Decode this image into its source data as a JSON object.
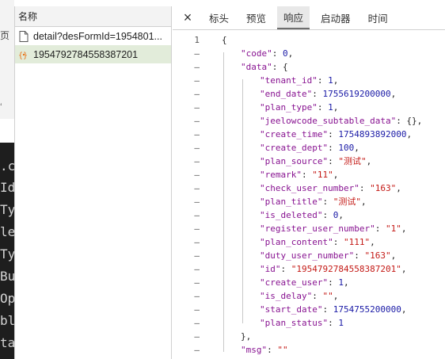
{
  "background": {
    "partial_chars": [
      "页",
      "ʻ",
      ".c",
      "Id",
      "Ty",
      "le",
      "Ty",
      "Bu",
      "Op",
      "bl",
      "ta"
    ]
  },
  "request_list": {
    "header": "名称",
    "items": [
      {
        "name": "detail?desFormId=1954801...",
        "icon": "document-icon",
        "selected": false
      },
      {
        "name": "1954792784558387201",
        "icon": "json-icon",
        "selected": true
      }
    ]
  },
  "tabs": {
    "close": "×",
    "items": [
      "标头",
      "预览",
      "响应",
      "启动器",
      "时间"
    ],
    "active": "响应"
  },
  "response": {
    "gutter_first": "1",
    "gutter_other": "–",
    "lines": [
      {
        "indent": 0,
        "parts": [
          {
            "t": "{",
            "c": "punc"
          }
        ]
      },
      {
        "indent": 1,
        "parts": [
          {
            "t": "\"code\"",
            "c": "key"
          },
          {
            "t": ": ",
            "c": "punc"
          },
          {
            "t": "0",
            "c": "num"
          },
          {
            "t": ",",
            "c": "punc"
          }
        ]
      },
      {
        "indent": 1,
        "parts": [
          {
            "t": "\"data\"",
            "c": "key"
          },
          {
            "t": ": {",
            "c": "punc"
          }
        ]
      },
      {
        "indent": 2,
        "parts": [
          {
            "t": "\"tenant_id\"",
            "c": "key"
          },
          {
            "t": ": ",
            "c": "punc"
          },
          {
            "t": "1",
            "c": "num"
          },
          {
            "t": ",",
            "c": "punc"
          }
        ]
      },
      {
        "indent": 2,
        "parts": [
          {
            "t": "\"end_date\"",
            "c": "key"
          },
          {
            "t": ": ",
            "c": "punc"
          },
          {
            "t": "1755619200000",
            "c": "num"
          },
          {
            "t": ",",
            "c": "punc"
          }
        ]
      },
      {
        "indent": 2,
        "parts": [
          {
            "t": "\"plan_type\"",
            "c": "key"
          },
          {
            "t": ": ",
            "c": "punc"
          },
          {
            "t": "1",
            "c": "num"
          },
          {
            "t": ",",
            "c": "punc"
          }
        ]
      },
      {
        "indent": 2,
        "parts": [
          {
            "t": "\"jeelowcode_subtable_data\"",
            "c": "key"
          },
          {
            "t": ": {},",
            "c": "punc"
          }
        ]
      },
      {
        "indent": 2,
        "parts": [
          {
            "t": "\"create_time\"",
            "c": "key"
          },
          {
            "t": ": ",
            "c": "punc"
          },
          {
            "t": "1754893892000",
            "c": "num"
          },
          {
            "t": ",",
            "c": "punc"
          }
        ]
      },
      {
        "indent": 2,
        "parts": [
          {
            "t": "\"create_dept\"",
            "c": "key"
          },
          {
            "t": ": ",
            "c": "punc"
          },
          {
            "t": "100",
            "c": "num"
          },
          {
            "t": ",",
            "c": "punc"
          }
        ]
      },
      {
        "indent": 2,
        "parts": [
          {
            "t": "\"plan_source\"",
            "c": "key"
          },
          {
            "t": ": ",
            "c": "punc"
          },
          {
            "t": "\"测试\"",
            "c": "str"
          },
          {
            "t": ",",
            "c": "punc"
          }
        ]
      },
      {
        "indent": 2,
        "parts": [
          {
            "t": "\"remark\"",
            "c": "key"
          },
          {
            "t": ": ",
            "c": "punc"
          },
          {
            "t": "\"11\"",
            "c": "str"
          },
          {
            "t": ",",
            "c": "punc"
          }
        ]
      },
      {
        "indent": 2,
        "parts": [
          {
            "t": "\"check_user_number\"",
            "c": "key"
          },
          {
            "t": ": ",
            "c": "punc"
          },
          {
            "t": "\"163\"",
            "c": "str"
          },
          {
            "t": ",",
            "c": "punc"
          }
        ]
      },
      {
        "indent": 2,
        "parts": [
          {
            "t": "\"plan_title\"",
            "c": "key"
          },
          {
            "t": ": ",
            "c": "punc"
          },
          {
            "t": "\"测试\"",
            "c": "str"
          },
          {
            "t": ",",
            "c": "punc"
          }
        ]
      },
      {
        "indent": 2,
        "parts": [
          {
            "t": "\"is_deleted\"",
            "c": "key"
          },
          {
            "t": ": ",
            "c": "punc"
          },
          {
            "t": "0",
            "c": "num"
          },
          {
            "t": ",",
            "c": "punc"
          }
        ]
      },
      {
        "indent": 2,
        "parts": [
          {
            "t": "\"register_user_number\"",
            "c": "key"
          },
          {
            "t": ": ",
            "c": "punc"
          },
          {
            "t": "\"1\"",
            "c": "str"
          },
          {
            "t": ",",
            "c": "punc"
          }
        ]
      },
      {
        "indent": 2,
        "parts": [
          {
            "t": "\"plan_content\"",
            "c": "key"
          },
          {
            "t": ": ",
            "c": "punc"
          },
          {
            "t": "\"111\"",
            "c": "str"
          },
          {
            "t": ",",
            "c": "punc"
          }
        ]
      },
      {
        "indent": 2,
        "parts": [
          {
            "t": "\"duty_user_number\"",
            "c": "key"
          },
          {
            "t": ": ",
            "c": "punc"
          },
          {
            "t": "\"163\"",
            "c": "str"
          },
          {
            "t": ",",
            "c": "punc"
          }
        ]
      },
      {
        "indent": 2,
        "parts": [
          {
            "t": "\"id\"",
            "c": "key"
          },
          {
            "t": ": ",
            "c": "punc"
          },
          {
            "t": "\"1954792784558387201\"",
            "c": "str"
          },
          {
            "t": ",",
            "c": "punc"
          }
        ]
      },
      {
        "indent": 2,
        "parts": [
          {
            "t": "\"create_user\"",
            "c": "key"
          },
          {
            "t": ": ",
            "c": "punc"
          },
          {
            "t": "1",
            "c": "num"
          },
          {
            "t": ",",
            "c": "punc"
          }
        ]
      },
      {
        "indent": 2,
        "parts": [
          {
            "t": "\"is_delay\"",
            "c": "key"
          },
          {
            "t": ": ",
            "c": "punc"
          },
          {
            "t": "\"\"",
            "c": "str"
          },
          {
            "t": ",",
            "c": "punc"
          }
        ]
      },
      {
        "indent": 2,
        "parts": [
          {
            "t": "\"start_date\"",
            "c": "key"
          },
          {
            "t": ": ",
            "c": "punc"
          },
          {
            "t": "1754755200000",
            "c": "num"
          },
          {
            "t": ",",
            "c": "punc"
          }
        ]
      },
      {
        "indent": 2,
        "parts": [
          {
            "t": "\"plan_status\"",
            "c": "key"
          },
          {
            "t": ": ",
            "c": "punc"
          },
          {
            "t": "1",
            "c": "num"
          }
        ]
      },
      {
        "indent": 1,
        "parts": [
          {
            "t": "},",
            "c": "punc"
          }
        ]
      },
      {
        "indent": 1,
        "parts": [
          {
            "t": "\"msg\"",
            "c": "key"
          },
          {
            "t": ": ",
            "c": "punc"
          },
          {
            "t": "\"\"",
            "c": "str"
          }
        ]
      }
    ]
  },
  "colors": {
    "key": "#881391",
    "string": "#c41a16",
    "number": "#1a1aa6",
    "selected_row": "#e2ecda"
  }
}
